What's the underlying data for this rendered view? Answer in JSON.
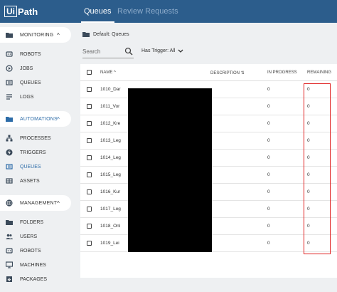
{
  "app": {
    "logo_box": "Ui",
    "logo_text": "Path",
    "tabs": [
      {
        "label": "Queues",
        "active": true
      },
      {
        "label": "Review Requests",
        "active": false
      }
    ]
  },
  "sidebar": {
    "sections": [
      {
        "label": "MONITORING",
        "chevron": "^",
        "items": [
          "ROBOTS",
          "JOBS",
          "QUEUES",
          "LOGS"
        ]
      },
      {
        "label": "AUTOMATIONS",
        "chevron": "^",
        "items": [
          "PROCESSES",
          "TRIGGERS",
          "QUEUES",
          "ASSETS"
        ]
      },
      {
        "label": "MANAGEMENT",
        "chevron": "^",
        "items": [
          "FOLDERS",
          "USERS",
          "ROBOTS",
          "MACHINES",
          "PACKAGES"
        ]
      }
    ]
  },
  "main": {
    "breadcrumb": "Default: Queues",
    "search_placeholder": "Search",
    "filter_label": "Has Trigger: All",
    "columns": [
      "NAME",
      "DESCRIPTION",
      "IN PROGRESS",
      "REMAINING"
    ],
    "name_sort_icon": "^",
    "description_sort_icon": "⇅",
    "rows": [
      {
        "name": "1010_Dar",
        "in_progress": "0",
        "remaining": "0"
      },
      {
        "name": "1011_Vor",
        "in_progress": "0",
        "remaining": "0"
      },
      {
        "name": "1012_Kre",
        "in_progress": "0",
        "remaining": "0"
      },
      {
        "name": "1013_Leg",
        "in_progress": "0",
        "remaining": "0"
      },
      {
        "name": "1014_Leg",
        "in_progress": "0",
        "remaining": "0"
      },
      {
        "name": "1015_Leg",
        "in_progress": "0",
        "remaining": "0"
      },
      {
        "name": "1016_Kur",
        "in_progress": "0",
        "remaining": "0"
      },
      {
        "name": "1017_Leg",
        "in_progress": "0",
        "remaining": "0"
      },
      {
        "name": "1018_Onl",
        "in_progress": "0",
        "remaining": "0"
      },
      {
        "name": "1019_Lei",
        "in_progress": "0",
        "remaining": "0"
      }
    ]
  },
  "colors": {
    "topbar": "#2c5d8c",
    "accent": "#2d6ca8",
    "highlight_box": "#e02020"
  }
}
